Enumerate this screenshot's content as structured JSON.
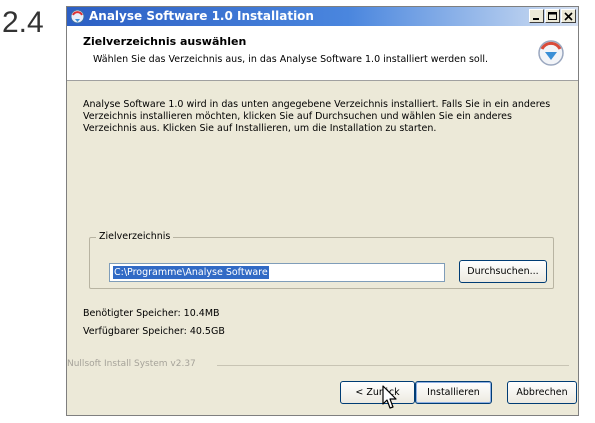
{
  "step": {
    "number": "2.4"
  },
  "window": {
    "title": "Analyse Software 1.0 Installation",
    "controls": [
      "minimize-icon",
      "maximize-icon",
      "close-icon"
    ]
  },
  "header": {
    "title": "Zielverzeichnis auswählen",
    "subtitle": "Wählen Sie das Verzeichnis aus, in das Analyse Software 1.0 installiert werden soll.",
    "icon": "installer-icon"
  },
  "body": {
    "text": "Analyse Software 1.0 wird in das unten angegebene Verzeichnis installiert. Falls Sie in ein anderes Verzeichnis installieren möchten, klicken Sie auf Durchsuchen und wählen Sie ein anderes Verzeichnis aus. Klicken Sie auf Installieren, um die Installation zu starten."
  },
  "destination": {
    "group_label": "Zielverzeichnis",
    "path_value": "C:\\Programme\\Analyse Software",
    "browse_label": "Durchsuchen..."
  },
  "space": {
    "required": "Benötigter Speicher: 10.4MB",
    "available": "Verfügbarer Speicher: 40.5GB"
  },
  "footer": {
    "branding": "Nullsoft Install System v2.37",
    "back_label": "< Zurück",
    "install_label": "Installieren",
    "cancel_label": "Abbrechen"
  },
  "colors": {
    "titlebar": "#2c5fc4",
    "selection": "#316ac5",
    "dialog_bg": "#ece9d8"
  }
}
